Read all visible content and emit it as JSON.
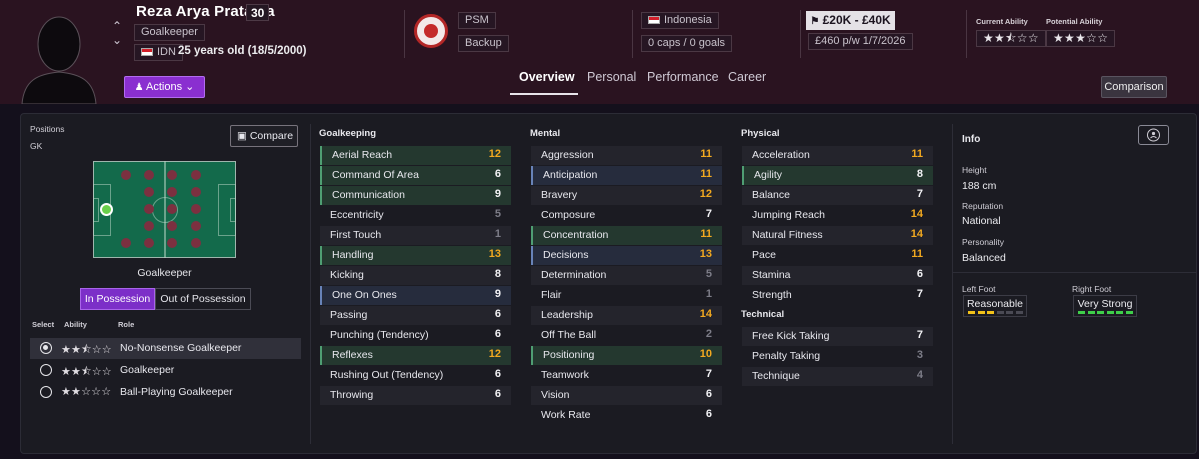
{
  "player": {
    "name": "Reza Arya Pratama",
    "age_badge": "30",
    "position": "Goalkeeper",
    "nation_code": "IDN",
    "age_text": "25 years old (18/5/2000)"
  },
  "header": {
    "actions_label": "Actions",
    "club": "PSM",
    "squad_status": "Backup",
    "nation": "Indonesia",
    "caps_goals": "0 caps / 0 goals",
    "value_range": "£20K - £40K",
    "wage_contract": "£460 p/w  1/7/2026",
    "current_ability_label": "Current Ability",
    "potential_ability_label": "Potential Ability",
    "current_ability_stars": "★★⯪☆☆",
    "potential_ability_stars": "★★★☆☆",
    "comparison_label": "Comparison"
  },
  "tabs": [
    {
      "label": "Overview",
      "active": true
    },
    {
      "label": "Personal",
      "active": false
    },
    {
      "label": "Performance",
      "active": false
    },
    {
      "label": "Career",
      "active": false
    }
  ],
  "positions": {
    "title": "Positions",
    "value": "GK",
    "compare_label": "Compare",
    "pitch_label": "Goalkeeper",
    "in_possession": "In Possession",
    "out_of_possession": "Out of Possession"
  },
  "roles": {
    "headers": [
      "Select",
      "Ability",
      "Role"
    ],
    "items": [
      {
        "stars": "★★⯪☆☆",
        "name": "No-Nonsense Goalkeeper",
        "selected": true
      },
      {
        "stars": "★★⯪☆☆",
        "name": "Goalkeeper",
        "selected": false
      },
      {
        "stars": "★★☆☆☆",
        "name": "Ball-Playing Goalkeeper",
        "selected": false
      }
    ]
  },
  "attributes": {
    "goalkeeping": {
      "title": "Goalkeeping",
      "rows": [
        {
          "name": "Aerial Reach",
          "value": "12",
          "hl": "green"
        },
        {
          "name": "Command Of Area",
          "value": "6",
          "hl": "green"
        },
        {
          "name": "Communication",
          "value": "9",
          "hl": "green"
        },
        {
          "name": "Eccentricity",
          "value": "5",
          "hl": ""
        },
        {
          "name": "First Touch",
          "value": "1",
          "hl": ""
        },
        {
          "name": "Handling",
          "value": "13",
          "hl": "green"
        },
        {
          "name": "Kicking",
          "value": "8",
          "hl": ""
        },
        {
          "name": "One On Ones",
          "value": "9",
          "hl": "blue"
        },
        {
          "name": "Passing",
          "value": "6",
          "hl": ""
        },
        {
          "name": "Punching (Tendency)",
          "value": "6",
          "hl": ""
        },
        {
          "name": "Reflexes",
          "value": "12",
          "hl": "green"
        },
        {
          "name": "Rushing Out (Tendency)",
          "value": "6",
          "hl": ""
        },
        {
          "name": "Throwing",
          "value": "6",
          "hl": ""
        }
      ]
    },
    "mental": {
      "title": "Mental",
      "rows": [
        {
          "name": "Aggression",
          "value": "11",
          "hl": ""
        },
        {
          "name": "Anticipation",
          "value": "11",
          "hl": "blue"
        },
        {
          "name": "Bravery",
          "value": "12",
          "hl": ""
        },
        {
          "name": "Composure",
          "value": "7",
          "hl": ""
        },
        {
          "name": "Concentration",
          "value": "11",
          "hl": "green"
        },
        {
          "name": "Decisions",
          "value": "13",
          "hl": "blue"
        },
        {
          "name": "Determination",
          "value": "5",
          "hl": ""
        },
        {
          "name": "Flair",
          "value": "1",
          "hl": ""
        },
        {
          "name": "Leadership",
          "value": "14",
          "hl": ""
        },
        {
          "name": "Off The Ball",
          "value": "2",
          "hl": ""
        },
        {
          "name": "Positioning",
          "value": "10",
          "hl": "green"
        },
        {
          "name": "Teamwork",
          "value": "7",
          "hl": ""
        },
        {
          "name": "Vision",
          "value": "6",
          "hl": ""
        },
        {
          "name": "Work Rate",
          "value": "6",
          "hl": ""
        }
      ]
    },
    "physical": {
      "title": "Physical",
      "rows": [
        {
          "name": "Acceleration",
          "value": "11",
          "hl": ""
        },
        {
          "name": "Agility",
          "value": "8",
          "hl": "green"
        },
        {
          "name": "Balance",
          "value": "7",
          "hl": ""
        },
        {
          "name": "Jumping Reach",
          "value": "14",
          "hl": ""
        },
        {
          "name": "Natural Fitness",
          "value": "14",
          "hl": ""
        },
        {
          "name": "Pace",
          "value": "11",
          "hl": ""
        },
        {
          "name": "Stamina",
          "value": "6",
          "hl": ""
        },
        {
          "name": "Strength",
          "value": "7",
          "hl": ""
        }
      ]
    },
    "technical": {
      "title": "Technical",
      "rows": [
        {
          "name": "Free Kick Taking",
          "value": "7",
          "hl": ""
        },
        {
          "name": "Penalty Taking",
          "value": "3",
          "hl": ""
        },
        {
          "name": "Technique",
          "value": "4",
          "hl": ""
        }
      ]
    }
  },
  "info": {
    "title": "Info",
    "height_label": "Height",
    "height": "188 cm",
    "reputation_label": "Reputation",
    "reputation": "National",
    "personality_label": "Personality",
    "personality": "Balanced",
    "left_foot_label": "Left Foot",
    "left_foot": "Reasonable",
    "left_foot_level": 3,
    "right_foot_label": "Right Foot",
    "right_foot": "Very Strong",
    "right_foot_level": 6
  },
  "colors": {
    "accent_purple": "#8a2fd0",
    "high_value": "#f2a920",
    "low_value": "#7d7d88",
    "foot_yellow": "#f2c21a",
    "foot_green": "#3fcf4a"
  }
}
